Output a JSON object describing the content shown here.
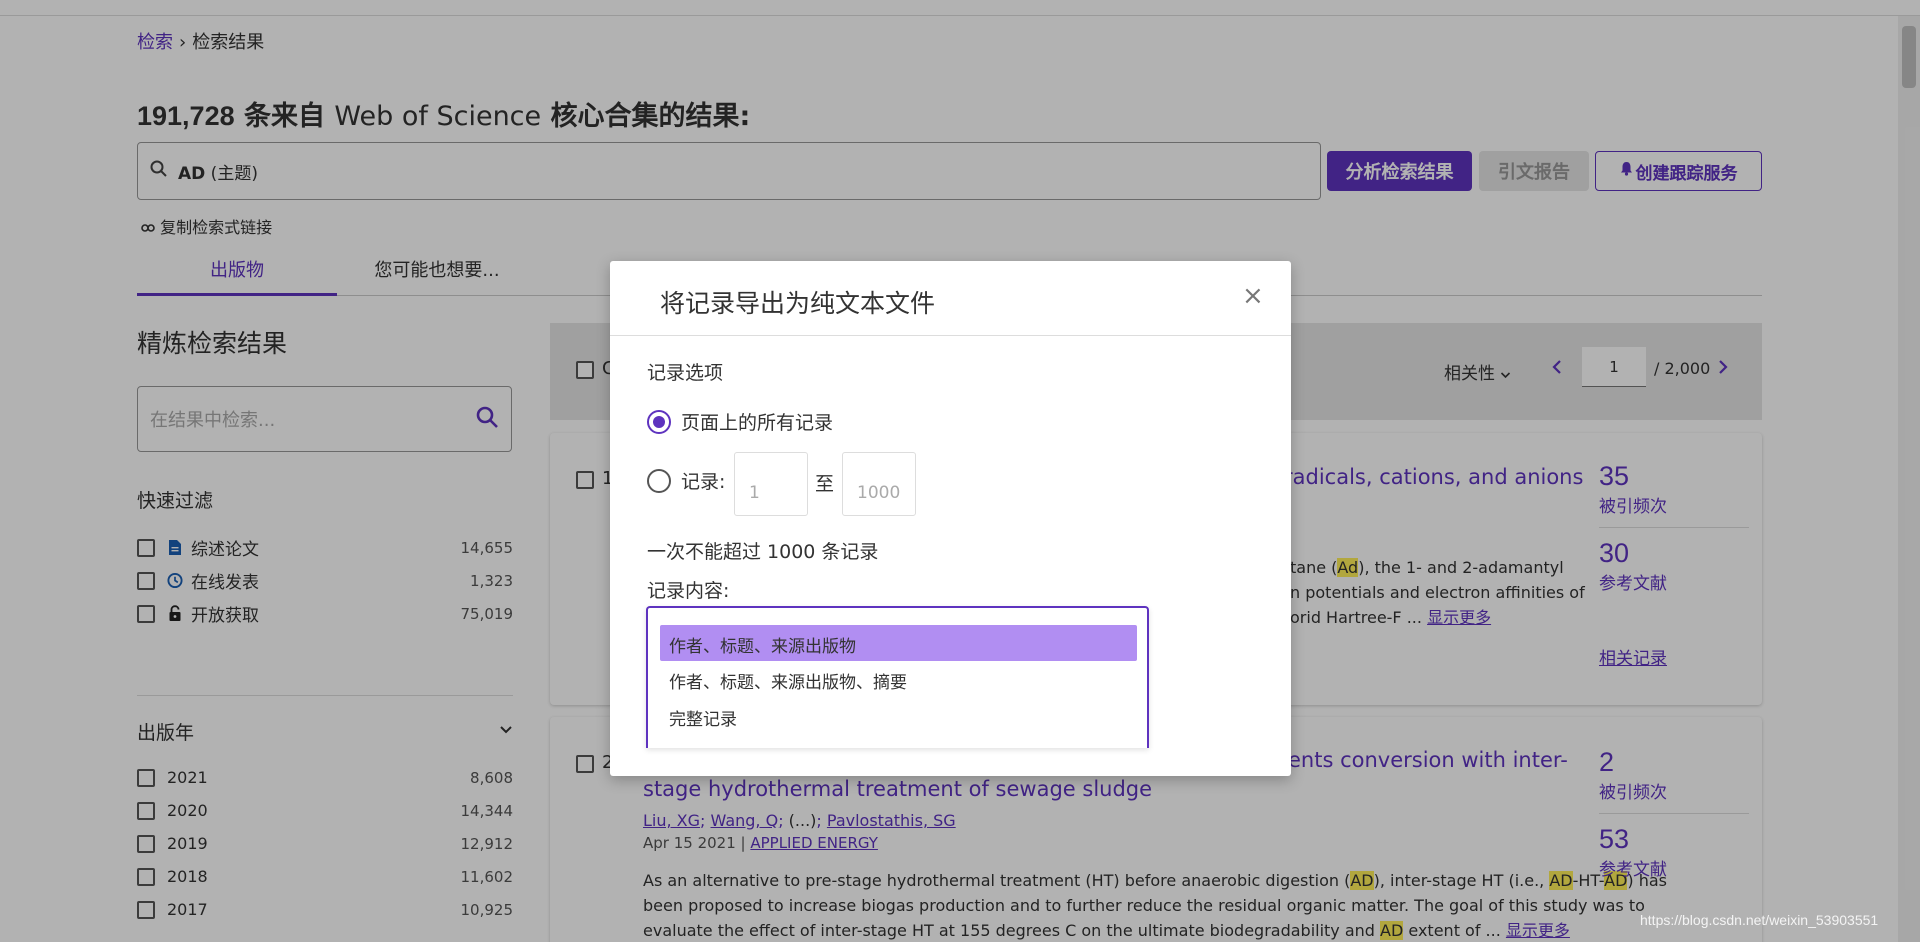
{
  "breadcrumb": {
    "search": "检索",
    "separator": "›",
    "current": "检索结果"
  },
  "results_header": {
    "count": "191,728",
    "prefix": " 条来自 ",
    "source": "Web of Science",
    "suffix": " 核心合集的结果:"
  },
  "search": {
    "field": "AD",
    "scope": " (主题)"
  },
  "actions": {
    "analyze": "分析检索结果",
    "citation_report": "引文报告",
    "create_alert": "创建跟踪服务"
  },
  "copy_link": "复制检索式链接",
  "tabs": [
    {
      "label": "出版物"
    },
    {
      "label": "您可能也想要..."
    }
  ],
  "refine": {
    "title": "精炼检索结果",
    "search_placeholder": "在结果中检索...",
    "quick_filter_title": "快速过滤",
    "quick_filters": [
      {
        "label": "综述论文",
        "count": "14,655"
      },
      {
        "label": "在线发表",
        "count": "1,323"
      },
      {
        "label": "开放获取",
        "count": "75,019"
      }
    ],
    "year_title": "出版年",
    "years": [
      {
        "label": "2021",
        "count": "8,608"
      },
      {
        "label": "2020",
        "count": "14,344"
      },
      {
        "label": "2019",
        "count": "12,912"
      },
      {
        "label": "2018",
        "count": "11,602"
      },
      {
        "label": "2017",
        "count": "10,925"
      }
    ]
  },
  "toolbar": {
    "select_partial": "C",
    "sort": "相关性",
    "page": "1",
    "total_pages": "/ 2,000"
  },
  "results": [
    {
      "index": "1",
      "title_visible": "radicals, cations, and anions",
      "abstract_lines": [
        {
          "parts": [
            "tane (",
            "Ad",
            "), the 1- and 2-adamantyl"
          ]
        },
        {
          "parts": [
            "n potentials and electron affinities of"
          ]
        },
        {
          "parts": [
            "orid Hartree-F ... "
          ]
        }
      ],
      "show_more": "显示更多",
      "cited": "35",
      "cited_label": "被引频次",
      "refs": "30",
      "refs_label": "参考文献",
      "related": "相关记录"
    },
    {
      "index": "2",
      "title_line1": "ents conversion with inter-",
      "title_line2": "stage hydrothermal treatment of sewage sludge",
      "authors": [
        "Liu, XG",
        "Wang, Q",
        "(...)",
        "Pavlostathis, SG"
      ],
      "date": "Apr 15 2021",
      "journal": "APPLIED ENERGY",
      "abstract_l1": [
        "As an alternative to pre-stage hydrothermal treatment (HT) before anaerobic digestion (",
        "AD",
        "), inter-stage HT (i.e., ",
        "AD",
        "-HT-",
        "AD",
        ") has"
      ],
      "abstract_l2": "been proposed to increase biogas production and to further reduce the residual organic matter. The goal of this study was to",
      "abstract_l3": [
        "evaluate the effect of inter-stage HT at 155 degrees C on the ultimate biodegradability and ",
        "AD",
        " extent of  ... "
      ],
      "show_more": "显示更多",
      "cited": "2",
      "cited_label": "被引频次",
      "refs": "53",
      "refs_label": "参考文献"
    }
  ],
  "modal": {
    "title": "将记录导出为纯文本文件",
    "close": "×",
    "options_title": "记录选项",
    "opt_all": "页面上的所有记录",
    "opt_range": "记录:",
    "range_from_placeholder": "1",
    "range_to_label": "至",
    "range_to_placeholder": "1000",
    "limit_note": "一次不能超过 1000 条记录",
    "content_label": "记录内容:",
    "content_options": [
      "作者、标题、来源出版物",
      "作者、标题、来源出版物、摘要",
      "完整记录"
    ]
  },
  "watermark": "https://blog.csdn.net/weixin_53903551",
  "colors": {
    "accent": "#5e33bf",
    "selected_option": "#b18ef2",
    "highlight": "#ffef5a"
  }
}
